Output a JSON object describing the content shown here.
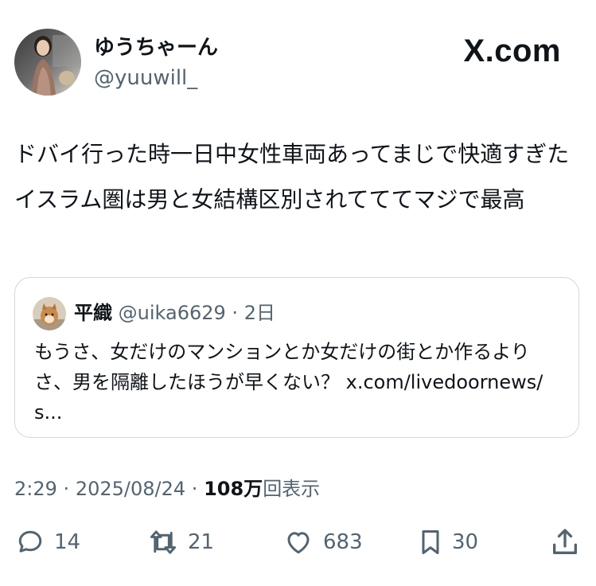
{
  "author": {
    "display_name": "ゆうちゃーん",
    "handle": "@yuuwill_"
  },
  "brand": "X.com",
  "tweet": {
    "text": "ドバイ行った時一日中女性車両あってまじで快適すぎたイスラム圏は男と女結構区別されてててマジで最高"
  },
  "quote": {
    "display_name": "平織",
    "handle": "@uika6629",
    "separator": "·",
    "time": "2日",
    "text": "もうさ、女だけのマンションとか女だけの街とか作るよりさ、男を隔離したほうが早くない？ x.com/livedoornews/s..."
  },
  "meta": {
    "time": "2:29",
    "sep": "·",
    "date": "2025/08/24",
    "sep2": "·",
    "views_number": "108万",
    "views_label": "回表示"
  },
  "actions": {
    "replies": "14",
    "reposts": "21",
    "likes": "683",
    "bookmarks": "30"
  },
  "icons": {
    "reply": "speech-bubble-icon",
    "repost": "repost-arrows-icon",
    "like": "heart-icon",
    "bookmark": "bookmark-icon",
    "share": "share-upload-icon"
  },
  "colors": {
    "text": "#0f1419",
    "secondary": "#536471",
    "border": "#cfd9de"
  }
}
